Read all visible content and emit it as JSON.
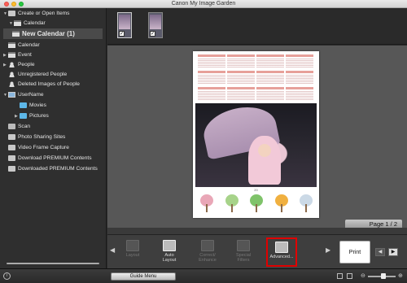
{
  "window": {
    "title": "Canon My Image Garden"
  },
  "sidebar": {
    "items": [
      {
        "label": "Create or Open Items",
        "arrow": "▼",
        "icon": "folder-icon"
      },
      {
        "label": "Calendar",
        "arrow": "▼",
        "icon": "calendar-icon"
      },
      {
        "label": "New Calendar (1)",
        "arrow": "",
        "icon": "calendar-icon",
        "selected": true
      },
      {
        "label": "Calendar",
        "arrow": "",
        "icon": "calendar-icon"
      },
      {
        "label": "Event",
        "arrow": "▶",
        "icon": "calendar-icon"
      },
      {
        "label": "People",
        "arrow": "▶",
        "icon": "people-icon"
      },
      {
        "label": "Unregistered People",
        "arrow": "",
        "icon": "people-icon"
      },
      {
        "label": "Deleted Images of People",
        "arrow": "",
        "icon": "people-icon"
      },
      {
        "label": "UserName",
        "arrow": "▼",
        "icon": "monitor-icon"
      },
      {
        "label": "Movies",
        "arrow": "",
        "icon": "folder-icon"
      },
      {
        "label": "Pictures",
        "arrow": "▶",
        "icon": "folder-icon"
      },
      {
        "label": "Scan",
        "arrow": "",
        "icon": "scan-icon"
      },
      {
        "label": "Photo Sharing Sites",
        "arrow": "",
        "icon": "sharing-icon"
      },
      {
        "label": "Video Frame Capture",
        "arrow": "",
        "icon": "video-icon"
      },
      {
        "label": "Download PREMIUM Contents",
        "arrow": "",
        "icon": "download-icon"
      },
      {
        "label": "Downloaded PREMIUM Contents",
        "arrow": "",
        "icon": "download-icon"
      }
    ]
  },
  "preview": {
    "page_indicator": "Page 1 / 2",
    "year_label": "20"
  },
  "toolbar": {
    "buttons": [
      {
        "label": "Layout",
        "enabled": false
      },
      {
        "label": "Auto\nLayout",
        "enabled": true
      },
      {
        "label": "Correct/\nEnhance",
        "enabled": false
      },
      {
        "label": "Special\nFilters",
        "enabled": false
      },
      {
        "label": "Advanced...",
        "enabled": true,
        "highlighted": true
      }
    ],
    "print_label": "Print"
  },
  "statusbar": {
    "guide_menu_label": "Guide Menu"
  },
  "colors": {
    "highlight": "#e00000",
    "sidebar_bg": "#2f2f2f",
    "preview_bg": "#575757"
  }
}
